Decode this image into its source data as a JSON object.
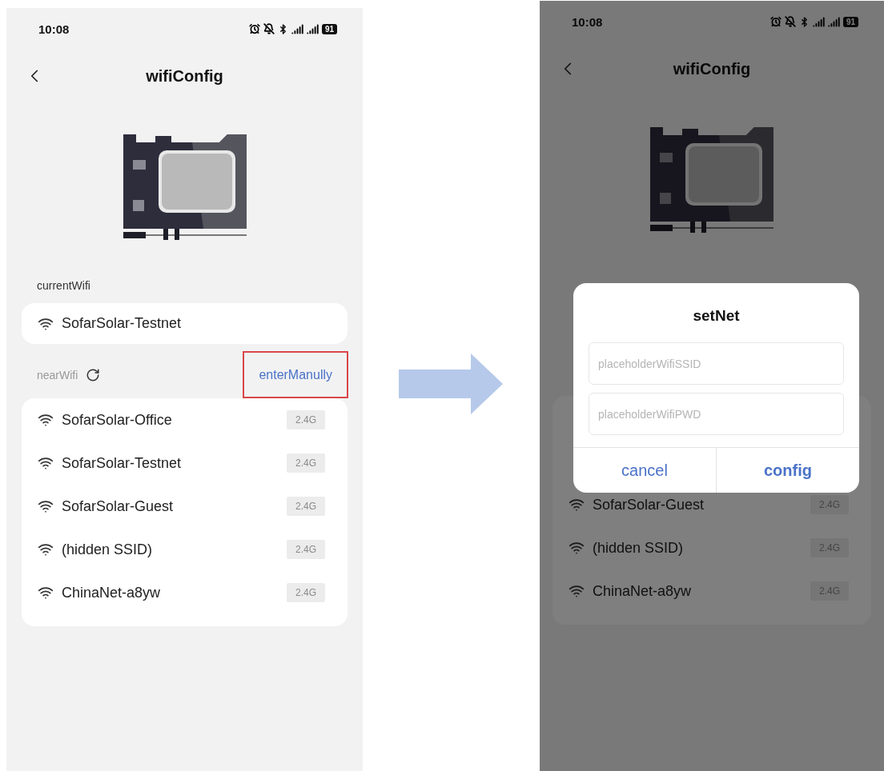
{
  "screens": [
    {
      "status_bar": {
        "time": "10:08",
        "battery": "91"
      },
      "title": "wifiConfig",
      "current_wifi": {
        "label": "currentWifi",
        "ssid": "SofarSolar-Testnet"
      },
      "near_wifi": {
        "label": "nearWifi",
        "action": {
          "label": "enterManully",
          "highlighted": true
        },
        "networks": [
          {
            "ssid": "SofarSolar-Office",
            "band": "2.4G"
          },
          {
            "ssid": "SofarSolar-Testnet",
            "band": "2.4G"
          },
          {
            "ssid": "SofarSolar-Guest",
            "band": "2.4G"
          },
          {
            "ssid": "(hidden SSID)",
            "band": "2.4G"
          },
          {
            "ssid": "ChinaNet-a8yw",
            "band": "2.4G"
          }
        ]
      },
      "dimmed": false
    },
    {
      "status_bar": {
        "time": "10:08",
        "battery": "91"
      },
      "title": "wifiConfig",
      "near_wifi": {
        "networks": [
          {
            "ssid": "SofarSolar-Guest",
            "band": "2.4G"
          },
          {
            "ssid": "(hidden SSID)",
            "band": "2.4G"
          },
          {
            "ssid": "ChinaNet-a8yw",
            "band": "2.4G"
          }
        ]
      },
      "dimmed": true,
      "dialog": {
        "title": "setNet",
        "fields": [
          {
            "placeholder": "placeholderWifiSSID"
          },
          {
            "placeholder": "placeholderWifiPWD"
          }
        ],
        "buttons": [
          {
            "label": "cancel",
            "kind": "secondary"
          },
          {
            "label": "config",
            "kind": "primary"
          }
        ]
      }
    }
  ]
}
